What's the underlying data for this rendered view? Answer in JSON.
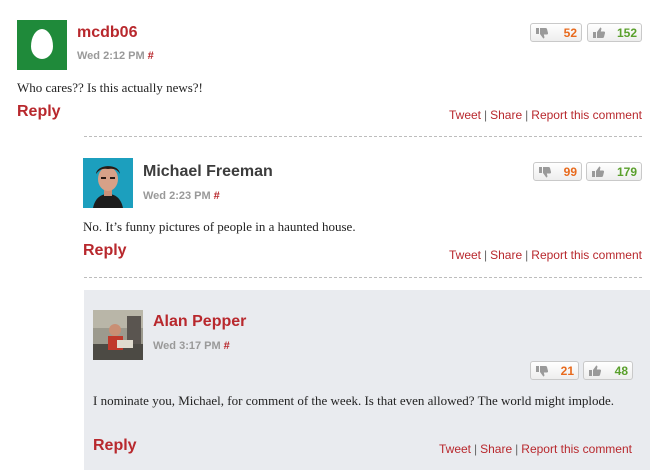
{
  "comments": [
    {
      "author": "mcdb06",
      "time": "Wed 2:12 PM",
      "permalink": "#",
      "text": "Who cares?? Is this actually news?!",
      "reply_label": "Reply",
      "votes": {
        "down": "52",
        "up": "152"
      },
      "avatar": "egg-avatar"
    },
    {
      "author": "Michael Freeman",
      "time": "Wed 2:23 PM",
      "permalink": "#",
      "text": "No. It’s funny pictures of people in a haunted house.",
      "reply_label": "Reply",
      "votes": {
        "down": "99",
        "up": "179"
      },
      "avatar": "photo-avatar"
    },
    {
      "author": "Alan Pepper",
      "time": "Wed 3:17 PM",
      "permalink": "#",
      "text": "I nominate you, Michael, for comment of the week. Is that even allowed? The world might implode.",
      "reply_label": "Reply",
      "votes": {
        "down": "21",
        "up": "48"
      },
      "avatar": "photo-avatar"
    }
  ],
  "actions": {
    "tweet": "Tweet",
    "share": "Share",
    "report": "Report this comment",
    "separator": "|"
  },
  "colors": {
    "accent": "#b8282d",
    "down": "#e86a1d",
    "up": "#5aa02c",
    "nested_bg": "#e9ebef"
  },
  "icons": {
    "down": "thumbs-down-icon",
    "up": "thumbs-up-icon"
  }
}
